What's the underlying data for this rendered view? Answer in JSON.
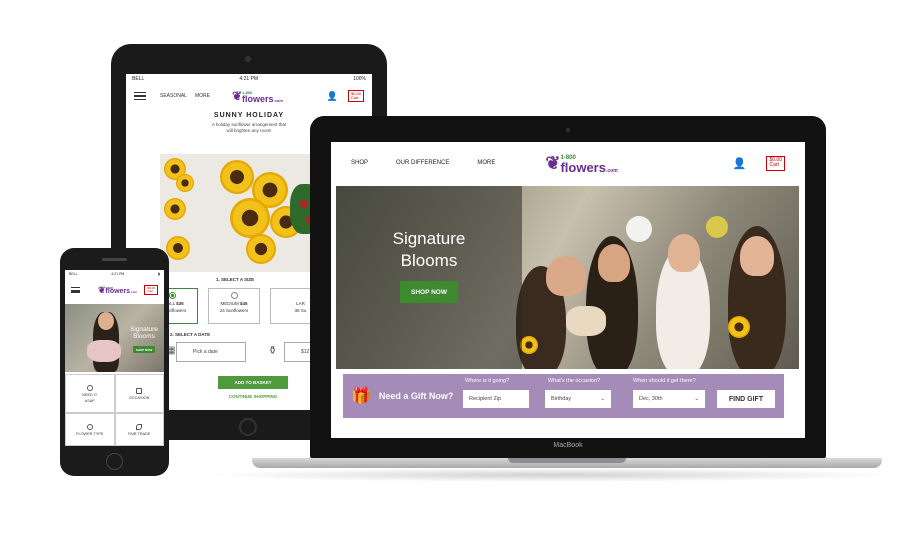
{
  "tablet": {
    "status": {
      "carrier": "BELL",
      "time": "4:21 PM",
      "battery": "100%"
    },
    "nav": {
      "seasonal": "SEASONAL",
      "more": "MORE"
    },
    "logo": {
      "num": "1-800",
      "word": "flowers",
      "dot": ".com"
    },
    "cart": {
      "amount": "$0.00",
      "label": "Cart"
    },
    "title": "SUNNY HOLIDAY",
    "subtitle_line1": "A holiday sunflower arrangement that",
    "subtitle_line2": "will brighten any room!",
    "step1": "1. SELECT A SIZE",
    "sizes": [
      {
        "name": "SMALL",
        "price": "$35",
        "desc": "12 Sunflowers"
      },
      {
        "name": "MEDIUM",
        "price": "$45",
        "desc": "24 Sunflowers"
      },
      {
        "name": "LAR",
        "price": "",
        "desc": "36 Su"
      }
    ],
    "step2": "2. SELECT A DATE",
    "step3": "3. INCLU",
    "date_placeholder": "Pick a date",
    "vase_text": "$12 V",
    "add_to_basket": "ADD TO BASKET",
    "continue": "CONTINUE SHOPPING"
  },
  "phone": {
    "status": {
      "carrier": "BELL",
      "time": "4:21 PM"
    },
    "logo": {
      "num": "1-800",
      "word": "flowers",
      "dot": ".com"
    },
    "cart": {
      "amount": "$0.00",
      "label": "Cart"
    },
    "hero_line1": "Signature",
    "hero_line2": "Blooms",
    "shop_now": "SHOP NOW",
    "grid": [
      {
        "l1": "NEED IT",
        "l2": "ASAP",
        "icon": "clock-icon"
      },
      {
        "l1": "OCCASION",
        "l2": "",
        "icon": "gift-icon"
      },
      {
        "l1": "FLOWER TYPE",
        "l2": "",
        "icon": "flower-icon"
      },
      {
        "l1": "FAIR TRADE",
        "l2": "",
        "icon": "leaf-icon"
      }
    ]
  },
  "laptop": {
    "brand": "MacBook",
    "nav": {
      "shop": "SHOP",
      "difference": "OUR DIFFERENCE",
      "more": "MORE"
    },
    "logo": {
      "num": "1-800",
      "word": "flowers",
      "dot": ".com"
    },
    "cart": {
      "amount": "$0.00",
      "label": "Cart"
    },
    "hero_line1": "Signature",
    "hero_line2": "Blooms",
    "shop_now": "SHOP NOW",
    "gift": {
      "title": "Need a Gift Now?",
      "where_label": "Where is it going?",
      "where_value": "Recipient Zip",
      "occasion_label": "What's the occasion?",
      "occasion_value": "Birthday",
      "when_label": "When should it get there?",
      "when_value": "Dec, 30th",
      "find": "FIND GIFT"
    }
  },
  "colors": {
    "brand_purple": "#6a2c91",
    "green": "#3d8a2f",
    "gift_band": "#a58bb8",
    "cart_red": "#cc0000"
  }
}
